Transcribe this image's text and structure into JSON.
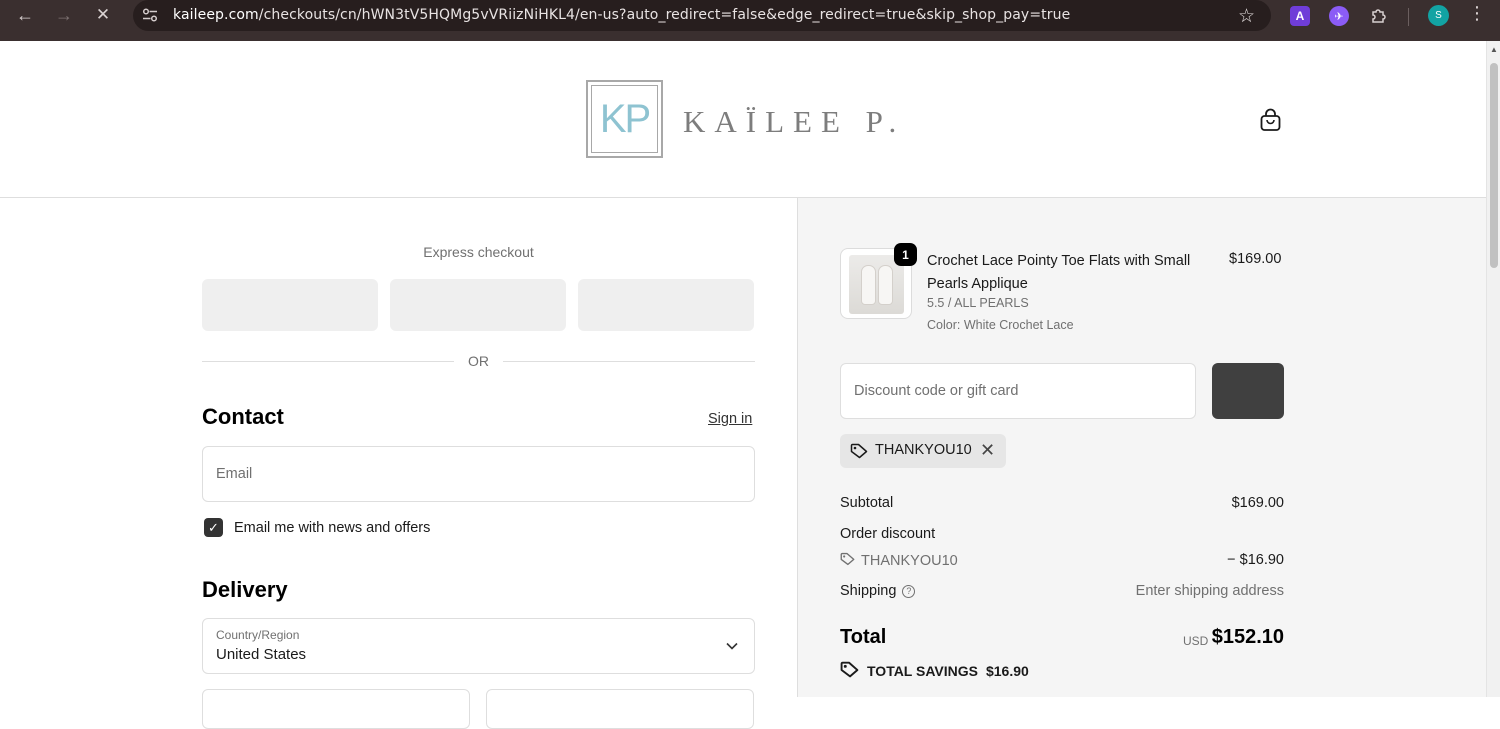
{
  "browser": {
    "url_host": "kaileep.com",
    "url_path": "/checkouts/cn/hWN3tV5HQMg5vVRiizNiHKL4/en-us?auto_redirect=false&edge_redirect=true&skip_shop_pay=true",
    "profile_initial": "S",
    "ext_a_label": "A"
  },
  "header": {
    "logo_monogram": "KP",
    "logo_wordmark": "KAÏLEE P."
  },
  "express": {
    "label": "Express checkout",
    "or_label": "OR"
  },
  "contact": {
    "heading": "Contact",
    "sign_in": "Sign in",
    "email_placeholder": "Email",
    "newsletter_label": "Email me with news and offers",
    "newsletter_checked": true
  },
  "delivery": {
    "heading": "Delivery",
    "country_label": "Country/Region",
    "country_value": "United States"
  },
  "order": {
    "item": {
      "quantity": "1",
      "name": "Crochet Lace Pointy Toe Flats with Small Pearls Applique",
      "variant": "5.5 / ALL PEARLS",
      "color": "Color: White Crochet Lace",
      "price": "$169.00"
    },
    "discount_placeholder": "Discount code or gift card",
    "applied_code": "THANKYOU10",
    "subtotal_label": "Subtotal",
    "subtotal_value": "$169.00",
    "order_discount_label": "Order discount",
    "discount_code": "THANKYOU10",
    "discount_value": "− $16.90",
    "shipping_label": "Shipping",
    "shipping_value": "Enter shipping address",
    "total_label": "Total",
    "total_currency": "USD",
    "total_value": "$152.10",
    "savings_label": "TOTAL SAVINGS",
    "savings_value": "$16.90"
  }
}
